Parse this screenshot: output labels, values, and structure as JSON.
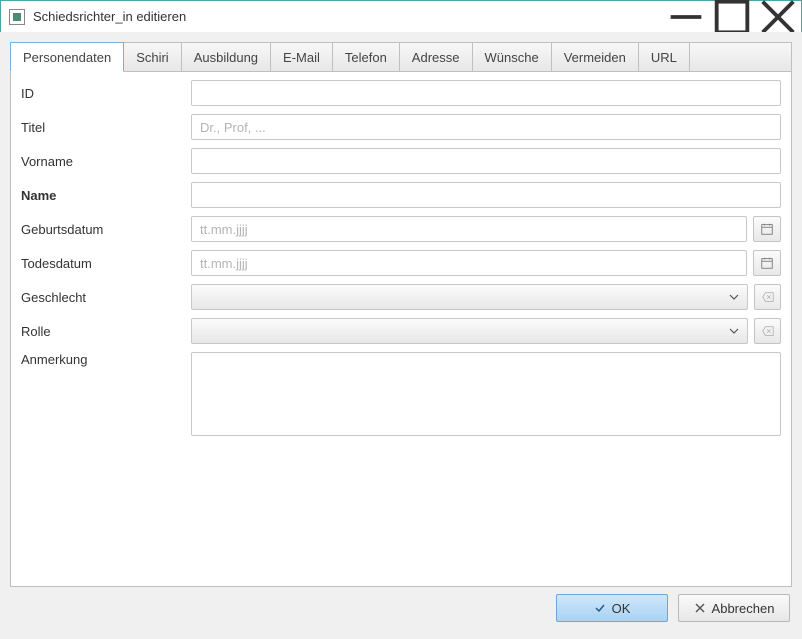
{
  "window": {
    "title": "Schiedsrichter_in editieren"
  },
  "tabs": [
    {
      "label": "Personendaten",
      "active": true
    },
    {
      "label": "Schiri"
    },
    {
      "label": "Ausbildung"
    },
    {
      "label": "E-Mail"
    },
    {
      "label": "Telefon"
    },
    {
      "label": "Adresse"
    },
    {
      "label": "Wünsche"
    },
    {
      "label": "Vermeiden"
    },
    {
      "label": "URL"
    }
  ],
  "form": {
    "id": {
      "label": "ID",
      "value": ""
    },
    "titel": {
      "label": "Titel",
      "value": "",
      "placeholder": "Dr., Prof, ..."
    },
    "vorname": {
      "label": "Vorname",
      "value": ""
    },
    "name": {
      "label": "Name",
      "value": ""
    },
    "geburtsdatum": {
      "label": "Geburtsdatum",
      "value": "",
      "placeholder": "tt.mm.jjjj"
    },
    "todesdatum": {
      "label": "Todesdatum",
      "value": "",
      "placeholder": "tt.mm.jjjj"
    },
    "geschlecht": {
      "label": "Geschlecht",
      "value": ""
    },
    "rolle": {
      "label": "Rolle",
      "value": ""
    },
    "anmerkung": {
      "label": "Anmerkung",
      "value": ""
    }
  },
  "buttons": {
    "ok": "OK",
    "cancel": "Abbrechen"
  }
}
